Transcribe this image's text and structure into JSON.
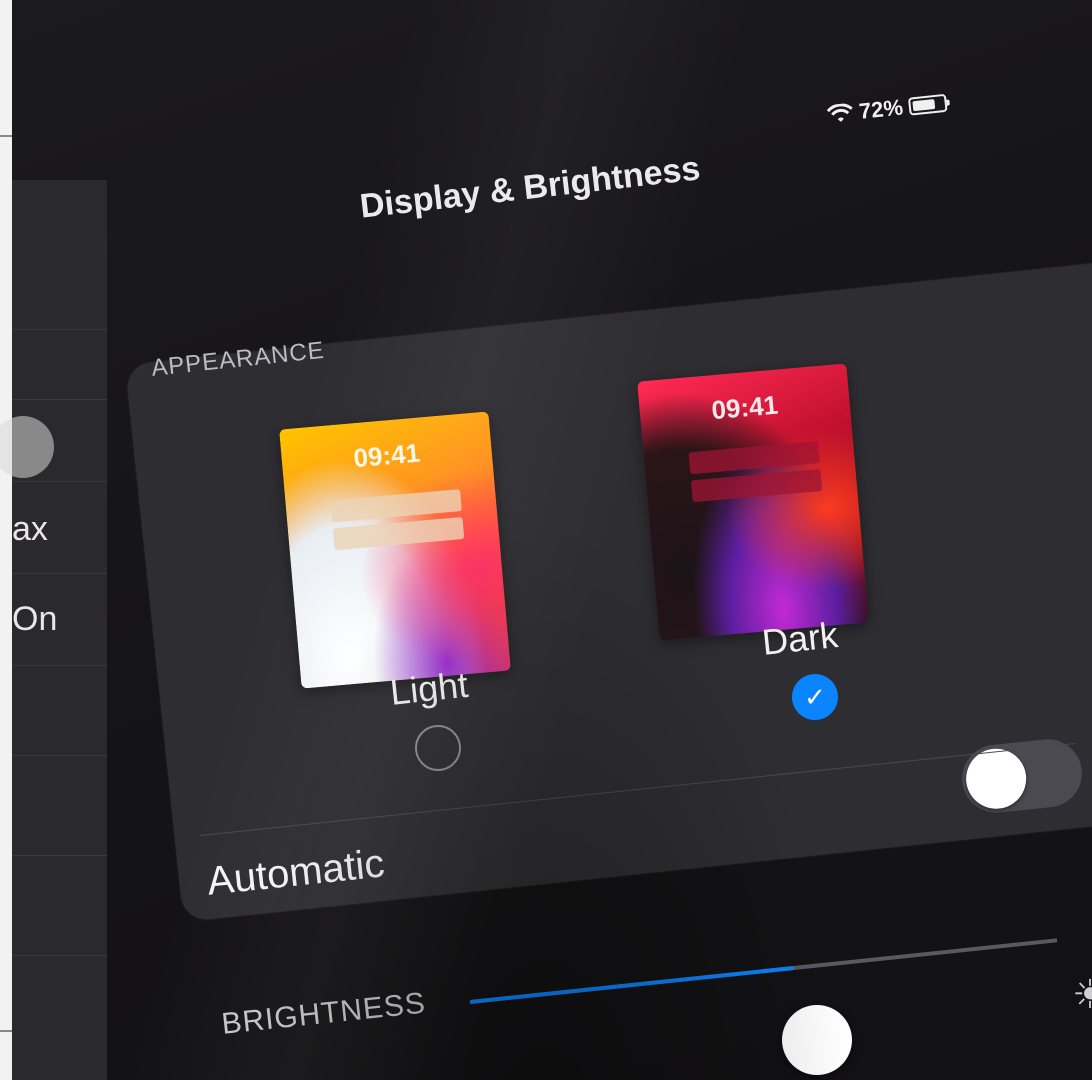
{
  "status_bar": {
    "battery_text": "72%",
    "battery_level": 0.72,
    "wifi_icon": "wifi-icon"
  },
  "header": {
    "title": "Display & Brightness"
  },
  "sidebar": {
    "items": [
      {
        "label": ""
      },
      {
        "label": ""
      },
      {
        "label": "",
        "control": "toggle"
      },
      {
        "label": "ax"
      },
      {
        "label": "On"
      },
      {
        "label": ""
      },
      {
        "label": ""
      },
      {
        "label": ""
      }
    ]
  },
  "appearance": {
    "section_label": "APPEARANCE",
    "options": [
      {
        "label": "Light",
        "preview_time": "09:41",
        "selected": false
      },
      {
        "label": "Dark",
        "preview_time": "09:41",
        "selected": true
      }
    ],
    "checkmark": "✓",
    "automatic_label": "Automatic",
    "automatic_on": false
  },
  "brightness": {
    "section_label": "BRIGHTNESS",
    "level": 0.55,
    "sun_icon": "sun-icon"
  },
  "colors": {
    "accent": "#0a84ff",
    "background": "#1b1a1c",
    "card": "#2e2d31"
  }
}
